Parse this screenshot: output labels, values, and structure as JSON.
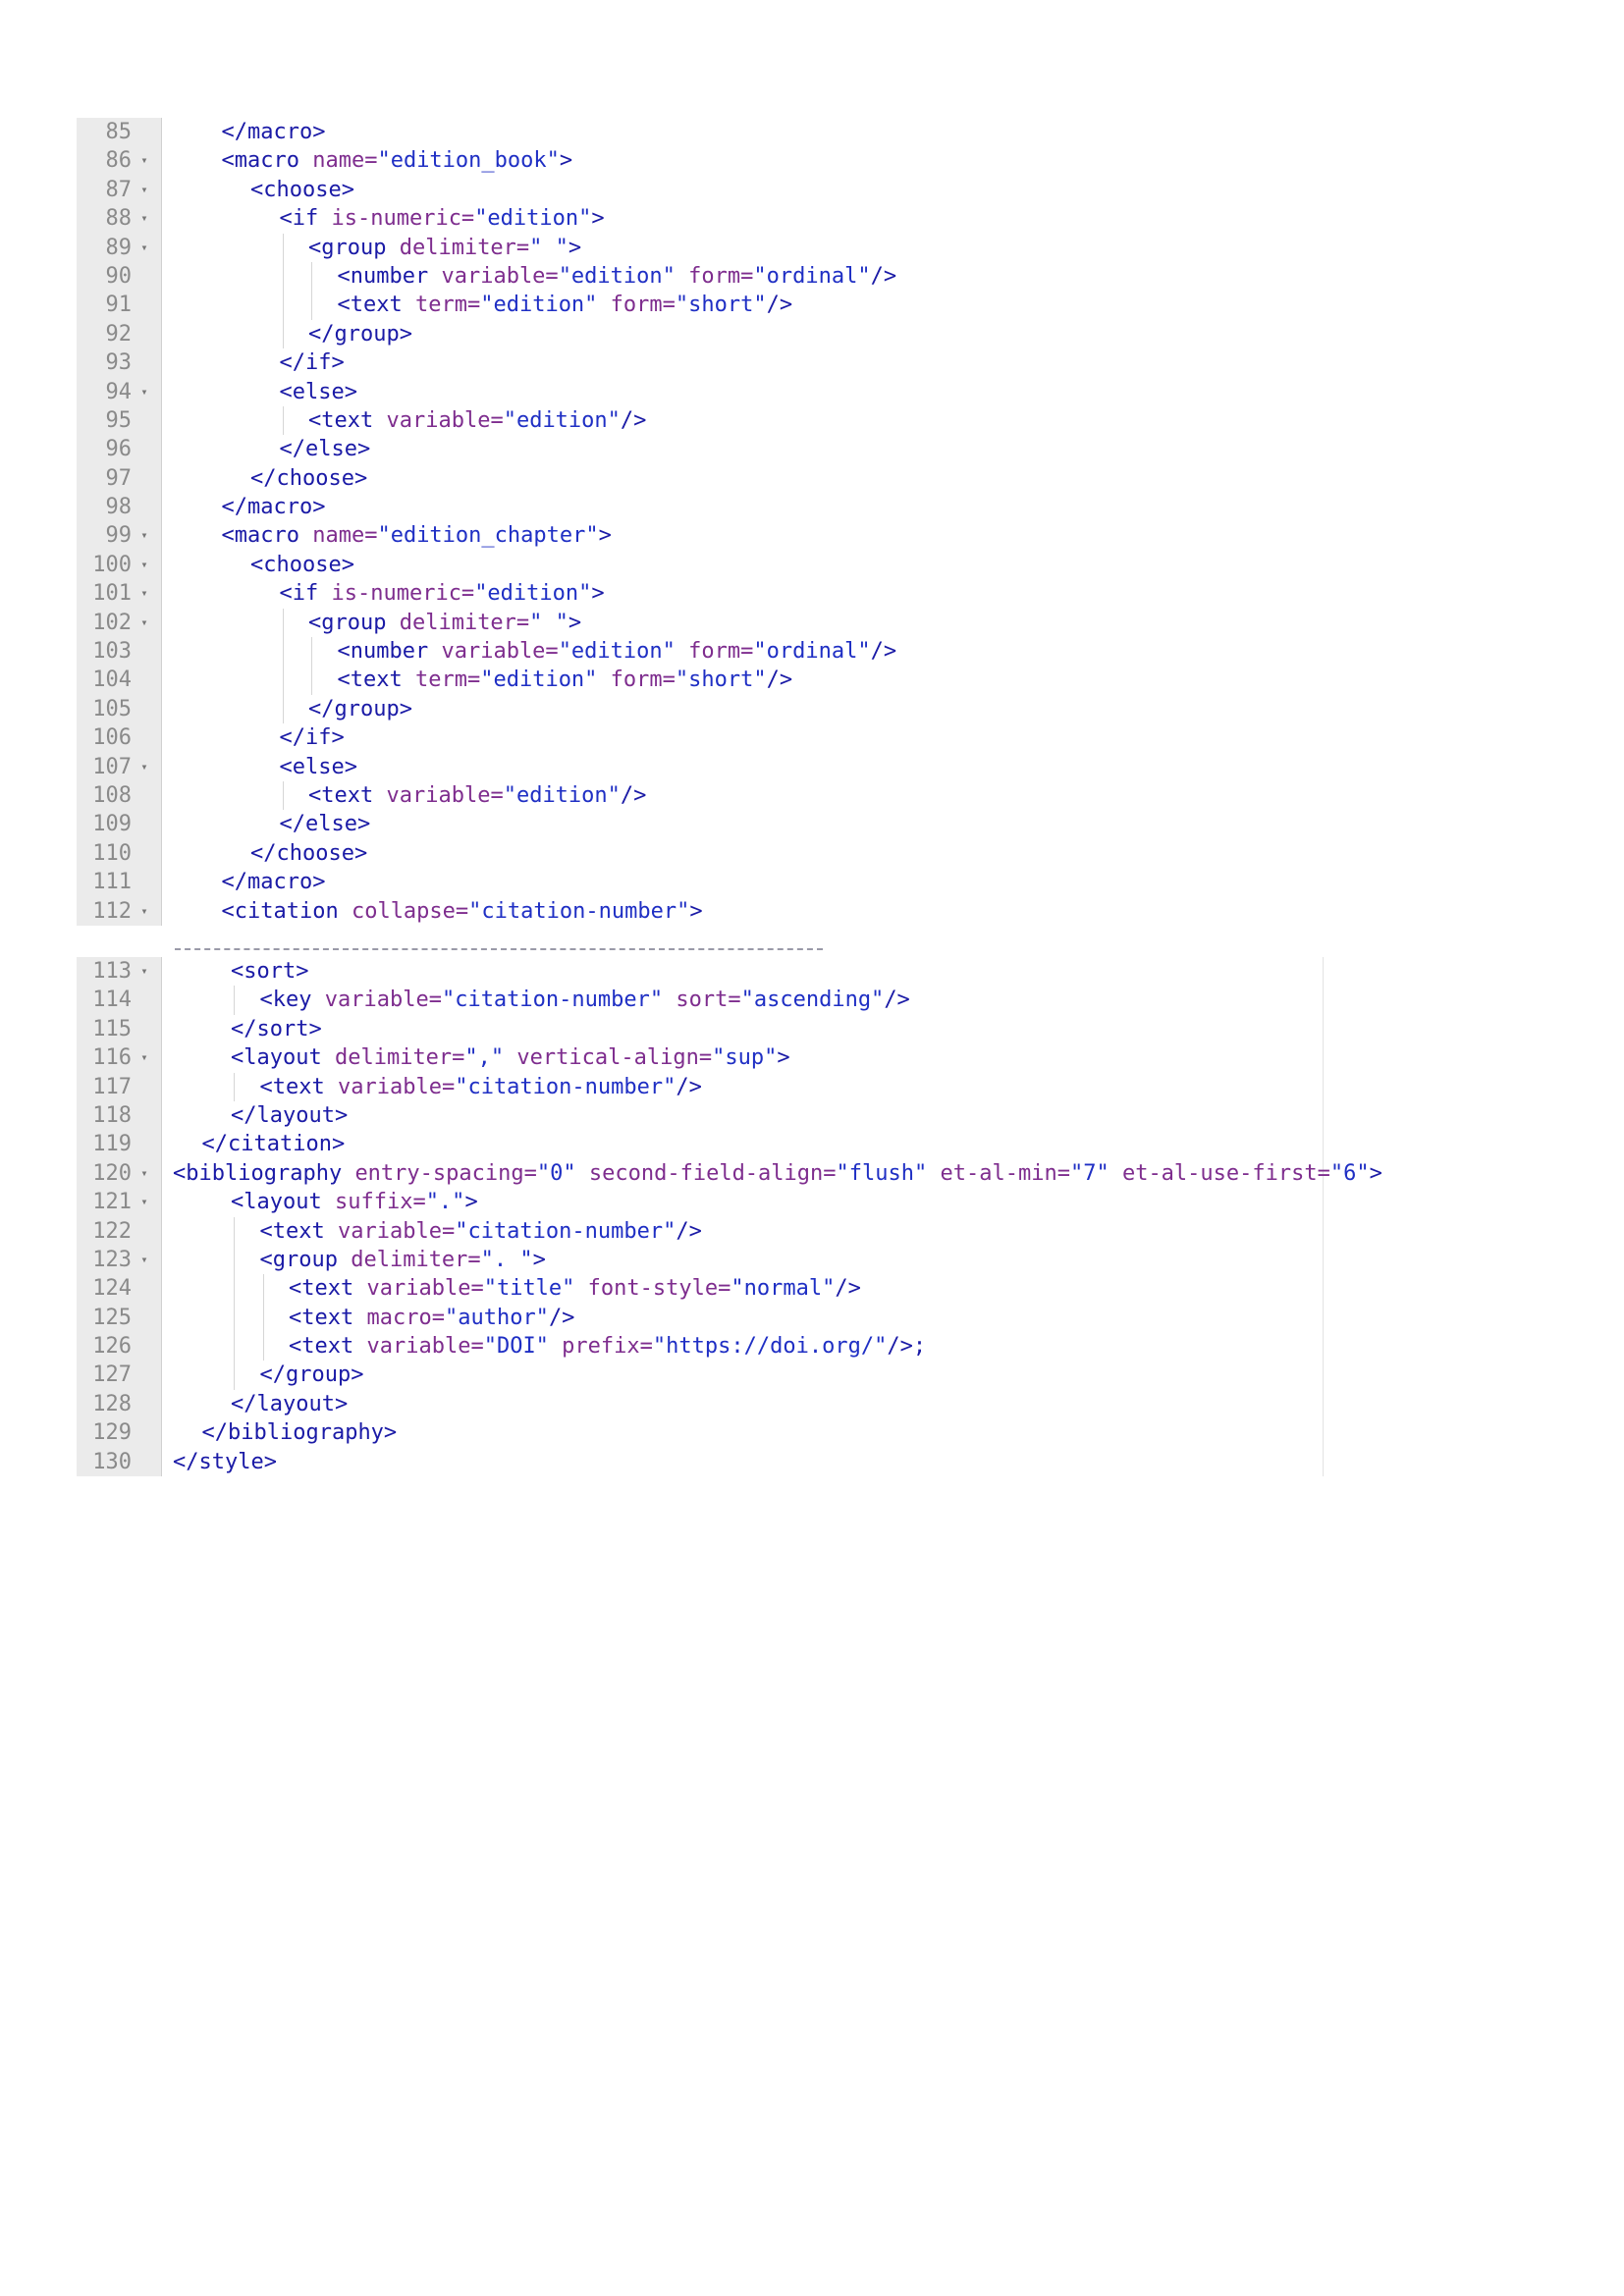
{
  "colors": {
    "tag": "#1a1aa6",
    "attr": "#7e2d8e",
    "string": "#1f2fc4",
    "gutter": "#ebebeb",
    "line_number": "#8a8a8a"
  },
  "fold_icon": "caret-down-icon",
  "panel1": [
    {
      "n": "85",
      "fold": false,
      "indent": 1,
      "t": [
        [
          "tag",
          "</macro>"
        ]
      ]
    },
    {
      "n": "86",
      "fold": true,
      "indent": 1,
      "t": [
        [
          "tag",
          "<macro "
        ],
        [
          "attr",
          "name="
        ],
        [
          "str",
          "\"edition_book\""
        ],
        [
          "tag",
          ">"
        ]
      ]
    },
    {
      "n": "87",
      "fold": true,
      "indent": 2,
      "t": [
        [
          "tag",
          "<choose>"
        ]
      ]
    },
    {
      "n": "88",
      "fold": true,
      "indent": 3,
      "t": [
        [
          "tag",
          "<if "
        ],
        [
          "attr",
          "is-numeric="
        ],
        [
          "str",
          "\"edition\""
        ],
        [
          "tag",
          ">"
        ]
      ]
    },
    {
      "n": "89",
      "fold": true,
      "indent": 4,
      "t": [
        [
          "tag",
          "<group "
        ],
        [
          "attr",
          "delimiter="
        ],
        [
          "str",
          "\" \""
        ],
        [
          "tag",
          ">"
        ]
      ]
    },
    {
      "n": "90",
      "fold": false,
      "indent": 5,
      "t": [
        [
          "tag",
          "<number "
        ],
        [
          "attr",
          "variable="
        ],
        [
          "str",
          "\"edition\""
        ],
        [
          "attr",
          " form="
        ],
        [
          "str",
          "\"ordinal\""
        ],
        [
          "tag",
          "/>"
        ]
      ]
    },
    {
      "n": "91",
      "fold": false,
      "indent": 5,
      "t": [
        [
          "tag",
          "<text "
        ],
        [
          "attr",
          "term="
        ],
        [
          "str",
          "\"edition\""
        ],
        [
          "attr",
          " form="
        ],
        [
          "str",
          "\"short\""
        ],
        [
          "tag",
          "/>"
        ]
      ]
    },
    {
      "n": "92",
      "fold": false,
      "indent": 4,
      "t": [
        [
          "tag",
          "</group>"
        ]
      ]
    },
    {
      "n": "93",
      "fold": false,
      "indent": 3,
      "t": [
        [
          "tag",
          "</if>"
        ]
      ]
    },
    {
      "n": "94",
      "fold": true,
      "indent": 3,
      "t": [
        [
          "tag",
          "<else>"
        ]
      ]
    },
    {
      "n": "95",
      "fold": false,
      "indent": 4,
      "t": [
        [
          "tag",
          "<text "
        ],
        [
          "attr",
          "variable="
        ],
        [
          "str",
          "\"edition\""
        ],
        [
          "tag",
          "/>"
        ]
      ]
    },
    {
      "n": "96",
      "fold": false,
      "indent": 3,
      "t": [
        [
          "tag",
          "</else>"
        ]
      ]
    },
    {
      "n": "97",
      "fold": false,
      "indent": 2,
      "t": [
        [
          "tag",
          "</choose>"
        ]
      ]
    },
    {
      "n": "98",
      "fold": false,
      "indent": 1,
      "t": [
        [
          "tag",
          "</macro>"
        ]
      ]
    },
    {
      "n": "99",
      "fold": true,
      "indent": 1,
      "t": [
        [
          "tag",
          "<macro "
        ],
        [
          "attr",
          "name="
        ],
        [
          "str",
          "\"edition_chapter\""
        ],
        [
          "tag",
          ">"
        ]
      ]
    },
    {
      "n": "100",
      "fold": true,
      "indent": 2,
      "t": [
        [
          "tag",
          "<choose>"
        ]
      ]
    },
    {
      "n": "101",
      "fold": true,
      "indent": 3,
      "t": [
        [
          "tag",
          "<if "
        ],
        [
          "attr",
          "is-numeric="
        ],
        [
          "str",
          "\"edition\""
        ],
        [
          "tag",
          ">"
        ]
      ]
    },
    {
      "n": "102",
      "fold": true,
      "indent": 4,
      "t": [
        [
          "tag",
          "<group "
        ],
        [
          "attr",
          "delimiter="
        ],
        [
          "str",
          "\" \""
        ],
        [
          "tag",
          ">"
        ]
      ]
    },
    {
      "n": "103",
      "fold": false,
      "indent": 5,
      "t": [
        [
          "tag",
          "<number "
        ],
        [
          "attr",
          "variable="
        ],
        [
          "str",
          "\"edition\""
        ],
        [
          "attr",
          " form="
        ],
        [
          "str",
          "\"ordinal\""
        ],
        [
          "tag",
          "/>"
        ]
      ]
    },
    {
      "n": "104",
      "fold": false,
      "indent": 5,
      "t": [
        [
          "tag",
          "<text "
        ],
        [
          "attr",
          "term="
        ],
        [
          "str",
          "\"edition\""
        ],
        [
          "attr",
          " form="
        ],
        [
          "str",
          "\"short\""
        ],
        [
          "tag",
          "/>"
        ]
      ]
    },
    {
      "n": "105",
      "fold": false,
      "indent": 4,
      "t": [
        [
          "tag",
          "</group>"
        ]
      ]
    },
    {
      "n": "106",
      "fold": false,
      "indent": 3,
      "t": [
        [
          "tag",
          "</if>"
        ]
      ]
    },
    {
      "n": "107",
      "fold": true,
      "indent": 3,
      "t": [
        [
          "tag",
          "<else>"
        ]
      ]
    },
    {
      "n": "108",
      "fold": false,
      "indent": 4,
      "t": [
        [
          "tag",
          "<text "
        ],
        [
          "attr",
          "variable="
        ],
        [
          "str",
          "\"edition\""
        ],
        [
          "tag",
          "/>"
        ]
      ]
    },
    {
      "n": "109",
      "fold": false,
      "indent": 3,
      "t": [
        [
          "tag",
          "</else>"
        ]
      ]
    },
    {
      "n": "110",
      "fold": false,
      "indent": 2,
      "t": [
        [
          "tag",
          "</choose>"
        ]
      ]
    },
    {
      "n": "111",
      "fold": false,
      "indent": 1,
      "t": [
        [
          "tag",
          "</macro>"
        ]
      ]
    },
    {
      "n": "112",
      "fold": true,
      "indent": 1,
      "t": [
        [
          "tag",
          "<citation "
        ],
        [
          "attr",
          "collapse="
        ],
        [
          "str",
          "\"citation-number\""
        ],
        [
          "tag",
          ">"
        ]
      ]
    }
  ],
  "panel2": [
    {
      "n": "113",
      "fold": true,
      "indent": 2,
      "t": [
        [
          "tag",
          "<sort>"
        ]
      ]
    },
    {
      "n": "114",
      "fold": false,
      "indent": 3,
      "t": [
        [
          "tag",
          "<key "
        ],
        [
          "attr",
          "variable="
        ],
        [
          "str",
          "\"citation-number\""
        ],
        [
          "attr",
          " sort="
        ],
        [
          "str",
          "\"ascending\""
        ],
        [
          "tag",
          "/>"
        ]
      ]
    },
    {
      "n": "115",
      "fold": false,
      "indent": 2,
      "t": [
        [
          "tag",
          "</sort>"
        ]
      ]
    },
    {
      "n": "116",
      "fold": true,
      "indent": 2,
      "t": [
        [
          "tag",
          "<layout "
        ],
        [
          "attr",
          "delimiter="
        ],
        [
          "str",
          "\",\""
        ],
        [
          "attr",
          " vertical-align="
        ],
        [
          "str",
          "\"sup\""
        ],
        [
          "tag",
          ">"
        ]
      ]
    },
    {
      "n": "117",
      "fold": false,
      "indent": 3,
      "t": [
        [
          "tag",
          "<text "
        ],
        [
          "attr",
          "variable="
        ],
        [
          "str",
          "\"citation-number\""
        ],
        [
          "tag",
          "/>"
        ]
      ]
    },
    {
      "n": "118",
      "fold": false,
      "indent": 2,
      "t": [
        [
          "tag",
          "</layout>"
        ]
      ]
    },
    {
      "n": "119",
      "fold": false,
      "indent": 1,
      "t": [
        [
          "tag",
          "</citation>"
        ]
      ]
    },
    {
      "n": "120",
      "fold": true,
      "indent": 0,
      "t": [
        [
          "tag",
          "<bibliography "
        ],
        [
          "attr",
          "entry-spacing="
        ],
        [
          "str",
          "\"0\""
        ],
        [
          "attr",
          " second-field-align="
        ],
        [
          "str",
          "\"flush\""
        ],
        [
          "attr",
          " et-al-min="
        ],
        [
          "str",
          "\"7\""
        ],
        [
          "attr",
          " et-al-use-first="
        ],
        [
          "str",
          "\"6\""
        ],
        [
          "tag",
          ">"
        ]
      ]
    },
    {
      "n": "121",
      "fold": true,
      "indent": 2,
      "t": [
        [
          "tag",
          "<layout "
        ],
        [
          "attr",
          "suffix="
        ],
        [
          "str",
          "\".\""
        ],
        [
          "tag",
          ">"
        ]
      ]
    },
    {
      "n": "122",
      "fold": false,
      "indent": 3,
      "t": [
        [
          "tag",
          "<text "
        ],
        [
          "attr",
          "variable="
        ],
        [
          "str",
          "\"citation-number\""
        ],
        [
          "tag",
          "/>"
        ]
      ]
    },
    {
      "n": "123",
      "fold": true,
      "indent": 3,
      "t": [
        [
          "tag",
          "<group "
        ],
        [
          "attr",
          "delimiter="
        ],
        [
          "str",
          "\". \""
        ],
        [
          "tag",
          ">"
        ]
      ]
    },
    {
      "n": "124",
      "fold": false,
      "indent": 4,
      "t": [
        [
          "tag",
          "<text "
        ],
        [
          "attr",
          "variable="
        ],
        [
          "str",
          "\"title\""
        ],
        [
          "attr",
          " font-style="
        ],
        [
          "str",
          "\"normal\""
        ],
        [
          "tag",
          "/>"
        ]
      ]
    },
    {
      "n": "125",
      "fold": false,
      "indent": 4,
      "t": [
        [
          "tag",
          "<text "
        ],
        [
          "attr",
          "macro="
        ],
        [
          "str",
          "\"author\""
        ],
        [
          "tag",
          "/>"
        ]
      ]
    },
    {
      "n": "126",
      "fold": false,
      "indent": 4,
      "t": [
        [
          "tag",
          "<text "
        ],
        [
          "attr",
          "variable="
        ],
        [
          "str",
          "\"DOI\""
        ],
        [
          "attr",
          " prefix="
        ],
        [
          "str",
          "\"https://doi.org/\""
        ],
        [
          "tag",
          "/>;"
        ]
      ]
    },
    {
      "n": "127",
      "fold": false,
      "indent": 3,
      "t": [
        [
          "tag",
          "</group>"
        ]
      ]
    },
    {
      "n": "128",
      "fold": false,
      "indent": 2,
      "t": [
        [
          "tag",
          "</layout>"
        ]
      ]
    },
    {
      "n": "129",
      "fold": false,
      "indent": 1,
      "t": [
        [
          "tag",
          "</bibliography>"
        ]
      ]
    },
    {
      "n": "130",
      "fold": false,
      "indent": 0,
      "t": [
        [
          "tag",
          "</style>"
        ]
      ]
    }
  ]
}
